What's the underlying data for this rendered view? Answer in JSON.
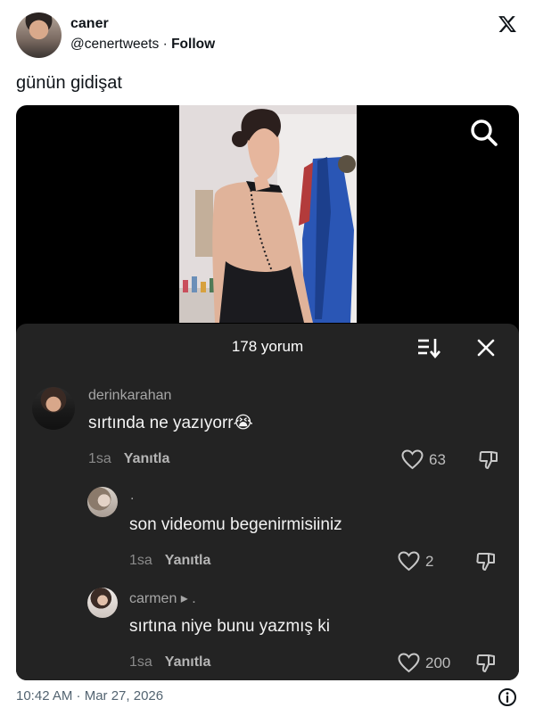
{
  "author": {
    "name": "caner",
    "handle": "@cenertweets",
    "separator": " · ",
    "follow_label": "Follow"
  },
  "tweet": {
    "text": "günün gidişat",
    "timestamp": "10:42 AM · Mar 27, 2026"
  },
  "icons": {
    "brand": "x-logo-icon",
    "media_search": "search-icon",
    "sort": "sort-icon",
    "close": "close-icon",
    "like": "heart-icon",
    "dislike": "thumbs-down-icon",
    "info": "info-icon"
  },
  "comments_panel": {
    "title": "178 yorum",
    "background": "#232323",
    "comments": [
      {
        "user": "derinkarahan",
        "text": "sırtında ne yazıyorr😭",
        "time": "1sa",
        "reply_label": "Yanıtla",
        "likes": "63"
      },
      {
        "user": ".",
        "text": "son videomu begenirmisiiniz",
        "time": "1sa",
        "reply_label": "Yanıtla",
        "likes": "2"
      },
      {
        "user": "carmen ▸ .",
        "text": "sırtına niye bunu yazmış ki",
        "time": "1sa",
        "reply_label": "Yanıtla",
        "likes": "200"
      }
    ]
  }
}
